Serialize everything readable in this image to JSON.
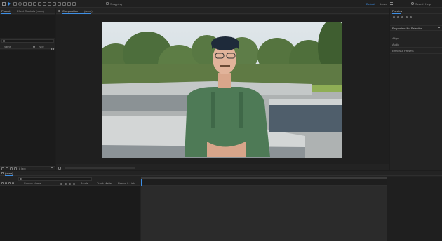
{
  "toolbar": {
    "snapping_label": "Snapping",
    "workspace_default": "Default",
    "workspace_learn": "Learn",
    "search_help_placeholder": "Search Help"
  },
  "project_panel": {
    "tab_project": "Project",
    "tab_effect_controls": "Effect Controls (none)",
    "search_placeholder": "",
    "col_name": "Name",
    "col_type": "Type",
    "bpc_label": "8 bpc"
  },
  "composition_panel": {
    "tab_label": "Composition",
    "comp_name": "(none)",
    "zoom_label": "",
    "view_label": ""
  },
  "right_panel": {
    "preview_tab": "Preview",
    "properties_title": "Properties: No Selection",
    "sections": [
      "Align",
      "Audio",
      "Effects & Presets"
    ]
  },
  "timeline": {
    "tab_label": "(none)",
    "search_placeholder": "",
    "col_source_name": "Source Name",
    "col_mode": "Mode",
    "col_trkmat": "Track Matte",
    "col_parent": "Parent & Link"
  },
  "colors": {
    "accent": "#3d8fe6",
    "panel_bg": "#232323",
    "app_bg": "#1d1d1d"
  }
}
